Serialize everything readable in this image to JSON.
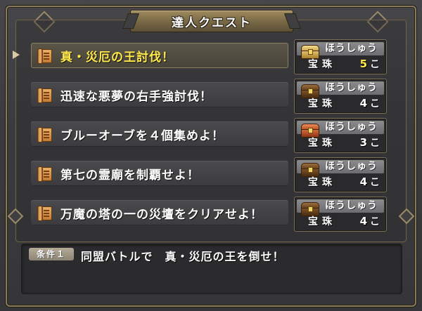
{
  "window": {
    "title": "達人クエスト"
  },
  "quests": [
    {
      "name": "真・災厄の王討伐！",
      "reward_label": "ほうしゅう",
      "reward_item": "宝珠",
      "reward_count": "5",
      "reward_unit": "こ",
      "chest_icon": "gold-chest-icon",
      "selected": true
    },
    {
      "name": "迅速な悪夢の右手強討伐！",
      "reward_label": "ほうしゅう",
      "reward_item": "宝珠",
      "reward_count": "4",
      "reward_unit": "こ",
      "chest_icon": "dark-chest-icon",
      "selected": false
    },
    {
      "name": "ブルーオーブを４個集めよ！",
      "reward_label": "ほうしゅう",
      "reward_item": "宝珠",
      "reward_count": "3",
      "reward_unit": "こ",
      "chest_icon": "red-chest-icon",
      "selected": false
    },
    {
      "name": "第七の霊廟を制覇せよ！",
      "reward_label": "ほうしゅう",
      "reward_item": "宝珠",
      "reward_count": "4",
      "reward_unit": "こ",
      "chest_icon": "dark-chest-icon",
      "selected": false
    },
    {
      "name": "万魔の塔の一の災壇をクリアせよ！",
      "reward_label": "ほうしゅう",
      "reward_item": "宝珠",
      "reward_count": "4",
      "reward_unit": "こ",
      "chest_icon": "dark-chest-icon",
      "selected": false
    }
  ],
  "condition": {
    "badge": "条件１",
    "text": "同盟バトルで　真・災厄の王を倒せ！"
  },
  "colors": {
    "selected_text": "#ffe94a",
    "normal_text": "#ffffff",
    "frame": "#8a7a5c",
    "background": "#3a3a3c"
  }
}
